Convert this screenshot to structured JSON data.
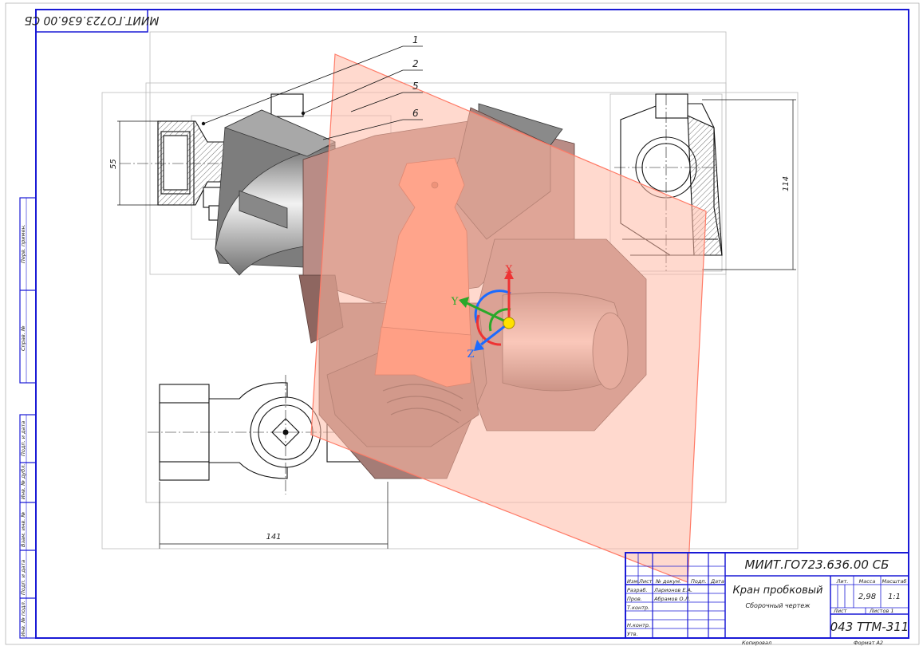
{
  "drawing": {
    "designation": "МИИТ.ГО723.636.00 СБ",
    "designation_stamp_rotated": "МИИТ.ГО723.636.00 СБ",
    "title": "Кран пробковый",
    "subtitle": "Сборочный чертеж",
    "group": "043 ТТМ-311",
    "mass": "2,98",
    "scale": "1:1",
    "sheet_label": "Лист",
    "sheets_label": "Листов 1",
    "copied_label": "Копировал",
    "format_label": "Формат А2"
  },
  "title_block": {
    "col_labels": [
      "Изм.",
      "Лист",
      "№ докум.",
      "Подп.",
      "Дата"
    ],
    "role_rows": [
      {
        "role": "Разраб.",
        "name": "Ларионов Е.А."
      },
      {
        "role": "Пров.",
        "name": "Абрамов О.Л."
      },
      {
        "role": "Т.контр.",
        "name": ""
      },
      {
        "role": "Н.контр.",
        "name": ""
      },
      {
        "role": "Утв.",
        "name": ""
      }
    ],
    "header_labels": [
      "Лит.",
      "Масса",
      "Масштаб"
    ]
  },
  "dimensions": {
    "left_height": "55",
    "right_height": "114",
    "bottom_width": "141"
  },
  "callouts": [
    "1",
    "2",
    "5",
    "6"
  ],
  "side_stamp_labels": [
    "Перв. примен.",
    "Справ. №",
    "Подп. и дата",
    "Инв. № дубл.",
    "Взам. инв. №",
    "Подп. и дата",
    "Инв. № подл."
  ],
  "axes": {
    "x_label": "X",
    "y_label": "Y",
    "z_label": "Z"
  },
  "colors": {
    "frame": "#1a1ad6",
    "body": "#b98c86",
    "body_dark": "#8e6660",
    "plug": "#ff8a6a",
    "plane": "#ffb9a6",
    "plane_edge": "#ff7a66",
    "steel": "#9a9a9a"
  }
}
